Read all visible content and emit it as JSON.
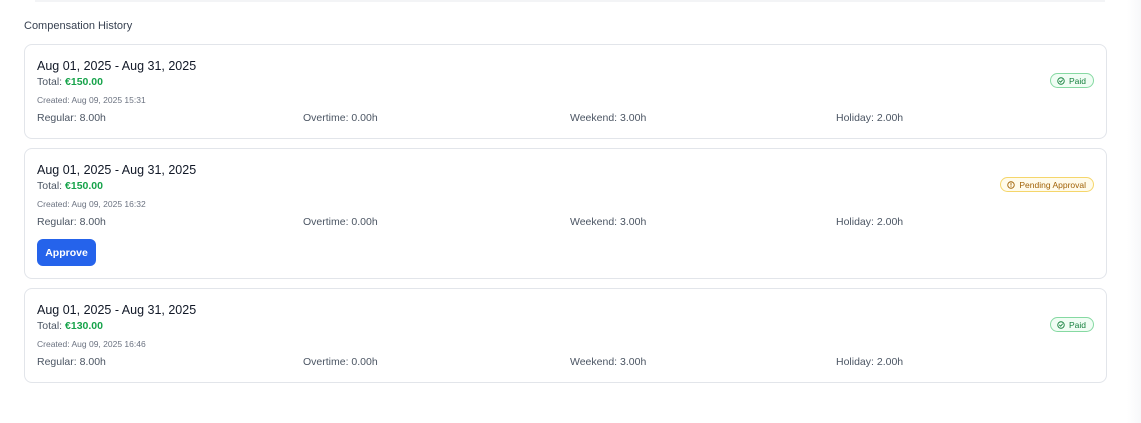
{
  "section_title": "Compensation History",
  "colors": {
    "accent": "#2563eb",
    "amount": "#16a34a",
    "paid": "#15803d",
    "pending": "#a16207"
  },
  "records": [
    {
      "period": "Aug 01, 2025 - Aug 31, 2025",
      "total_label": "Total:",
      "total_value": "€150.00",
      "created": "Created: Aug 09, 2025 15:31",
      "regular": "Regular: 8.00h",
      "overtime": "Overtime: 0.00h",
      "weekend": "Weekend: 3.00h",
      "holiday": "Holiday: 2.00h",
      "status": "Paid",
      "status_icon": "check-circle-icon"
    },
    {
      "period": "Aug 01, 2025 - Aug 31, 2025",
      "total_label": "Total:",
      "total_value": "€150.00",
      "created": "Created: Aug 09, 2025 16:32",
      "regular": "Regular: 8.00h",
      "overtime": "Overtime: 0.00h",
      "weekend": "Weekend: 3.00h",
      "holiday": "Holiday: 2.00h",
      "status": "Pending Approval",
      "status_icon": "alert-circle-icon",
      "action_label": "Approve"
    },
    {
      "period": "Aug 01, 2025 - Aug 31, 2025",
      "total_label": "Total:",
      "total_value": "€130.00",
      "created": "Created: Aug 09, 2025 16:46",
      "regular": "Regular: 8.00h",
      "overtime": "Overtime: 0.00h",
      "weekend": "Weekend: 3.00h",
      "holiday": "Holiday: 2.00h",
      "status": "Paid",
      "status_icon": "check-circle-icon"
    }
  ]
}
